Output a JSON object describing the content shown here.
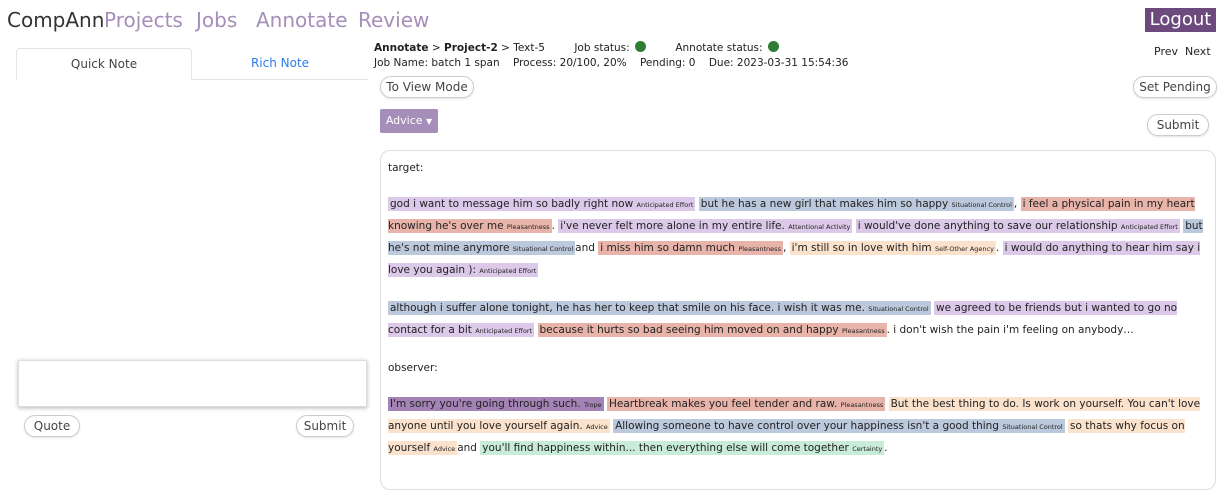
{
  "nav": {
    "brand": "CompAnn",
    "links": [
      "Projects",
      "Jobs",
      "Annotate",
      "Review"
    ],
    "logout": "Logout"
  },
  "left": {
    "tabs": [
      "Quick Note",
      "Rich Note"
    ],
    "note_value": "",
    "quote_button": "Quote",
    "submit_button": "Submit"
  },
  "header": {
    "crumb_section": "Annotate",
    "crumb_sep": ">",
    "crumb_project": "Project-2",
    "crumb_text": "Text-5",
    "job_status_label": "Job status:",
    "annotate_status_label": "Annotate status:",
    "status_color": "#2e7d32",
    "job_line": "Job Name: batch 1 span    Process: 20/100, 20%    Pending: 0    Due: 2023-03-31 15:54:36",
    "prev": "Prev",
    "next": "Next"
  },
  "toolbar": {
    "view_mode": "To View Mode",
    "set_pending": "Set Pending",
    "advice": "Advice",
    "submit": "Submit"
  },
  "document": {
    "target_title": "target:",
    "observer_title": "observer:",
    "target_p1": [
      {
        "t": "god i want to message him so badly right now",
        "tag": "Anticipated Effort",
        "cls": "c-ae"
      },
      {
        "t": "but he has a new girl that makes him so happy",
        "tag": "Situational Control",
        "cls": "c-sc",
        "after": ","
      },
      {
        "t": "i feel a physical pain in my heart knowing he's over me",
        "tag": "Pleasantness",
        "cls": "c-pl",
        "after": "."
      },
      {
        "t": "i've never felt more alone in my entire life.",
        "tag": "Attentional Activity",
        "cls": "c-aa"
      },
      {
        "t": "i would've done anything to save our relationship",
        "tag": "Anticipated Effort",
        "cls": "c-ae"
      },
      {
        "t": "but he's not mine anymore",
        "tag": "Situational Control",
        "cls": "c-sc",
        "after": "and"
      },
      {
        "t": "i miss him so damn much",
        "tag": "Pleasantness",
        "cls": "c-pl",
        "after": ","
      },
      {
        "t": "i'm still so in love with him",
        "tag": "Self-Other Agency",
        "cls": "c-so",
        "after": "."
      },
      {
        "t": "i would do anything to hear him say i love you again ):",
        "tag": "Anticipated Effort",
        "cls": "c-ae"
      }
    ],
    "target_p2": [
      {
        "t": "although i suffer alone tonight, he has her to keep that smile on his face. i wish it was me.",
        "tag": "Situational Control",
        "cls": "c-sc"
      },
      {
        "t": "we agreed to be friends but i wanted to go no contact for a bit",
        "tag": "Anticipated Effort",
        "cls": "c-ae"
      },
      {
        "t": "because it hurts so bad seeing him moved on and happy",
        "tag": "Pleasantness",
        "cls": "c-pl",
        "after": ". i don't wish the pain i'm feeling on anybody…"
      }
    ],
    "observer_p1": [
      {
        "t": "I'm sorry you're going through such.",
        "tag": "Trope",
        "cls": "c-tr"
      },
      {
        "t": "Heartbreak makes you  feel tender and raw.",
        "tag": "Pleasantness",
        "cls": "c-pl"
      },
      {
        "t": "But the best thing to do. Is work on yourself. You can't love anyone until you love yourself again.",
        "tag": "Advice",
        "cls": "c-ad"
      },
      {
        "t": "Allowing someone to have control over your happiness isn't a good thing",
        "tag": "Situational Control",
        "cls": "c-sc"
      },
      {
        "t": "so thats why focus on yourself",
        "tag": "Advice",
        "cls": "c-ad",
        "after": "and"
      },
      {
        "t": "you'll find happiness within... then everything else will come together",
        "tag": "Certainty",
        "cls": "c-ce",
        "after": "."
      }
    ]
  }
}
